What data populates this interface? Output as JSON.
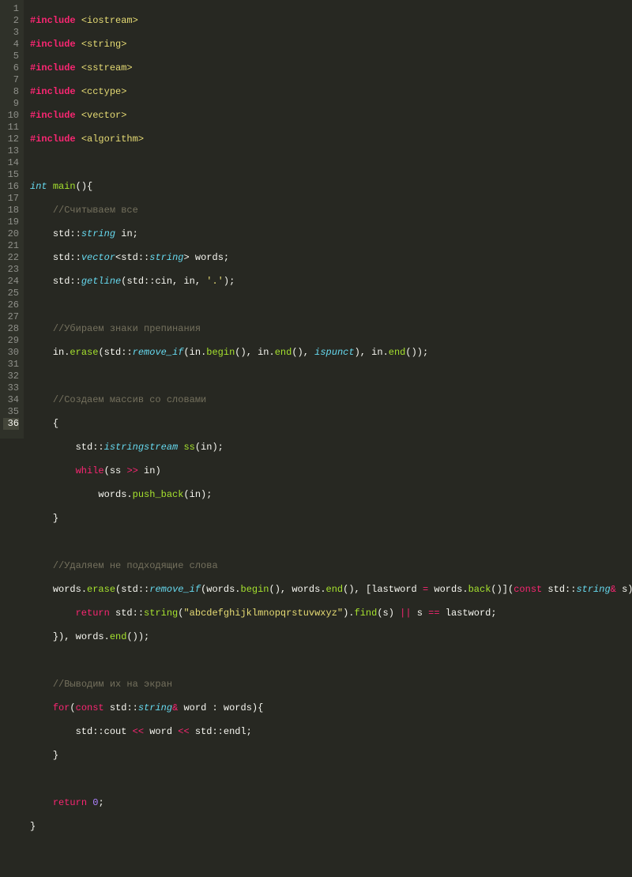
{
  "gutter": {
    "start": 1,
    "end": 36,
    "active": 36
  },
  "code": {
    "l1": {
      "include": "#include",
      "hdr": "<iostream>"
    },
    "l2": {
      "include": "#include",
      "hdr": "<string>"
    },
    "l3": {
      "include": "#include",
      "hdr": "<sstream>"
    },
    "l4": {
      "include": "#include",
      "hdr": "<cctype>"
    },
    "l5": {
      "include": "#include",
      "hdr": "<vector>"
    },
    "l6": {
      "include": "#include",
      "hdr": "<algorithm>"
    },
    "l8": {
      "kw": "int",
      "fn": "main",
      "rest": "(){"
    },
    "l9": {
      "c": "//Считываем все"
    },
    "l10": {
      "a": "std::",
      "b": "string",
      "c": " in;"
    },
    "l11": {
      "a": "std::",
      "b": "vector",
      "c": "<std::",
      "d": "string",
      "e": "> words;"
    },
    "l12": {
      "a": "std::",
      "b": "getline",
      "c": "(std::cin, in, ",
      "d": "'.'",
      "e": ");"
    },
    "l14": {
      "c": "//Убираем знаки препинания"
    },
    "l15": {
      "a": "in.",
      "b": "erase",
      "c": "(std::",
      "d": "remove_if",
      "e": "(in.",
      "f": "begin",
      "g": "(), in.",
      "h": "end",
      "i": "(), ",
      "j": "ispunct",
      "k": "), in.",
      "l": "end",
      "m": "());"
    },
    "l17": {
      "c": "//Создаем массив со словами"
    },
    "l18": {
      "a": "{"
    },
    "l19": {
      "a": "std::",
      "b": "istringstream",
      "c": " ",
      "d": "ss",
      "e": "(in);"
    },
    "l20": {
      "a": "while",
      "b": "(ss ",
      "c": ">>",
      "d": " in)"
    },
    "l21": {
      "a": "words.",
      "b": "push_back",
      "c": "(in);"
    },
    "l22": {
      "a": "}"
    },
    "l24": {
      "c": "//Удаляем не подходящие слова"
    },
    "l25": {
      "a": "words.",
      "b": "erase",
      "c": "(std::",
      "d": "remove_if",
      "e": "(words.",
      "f": "begin",
      "g": "(), words.",
      "h": "end",
      "i": "(), [lastword ",
      "j": "=",
      "k": " words.",
      "l": "back",
      "m": "()](",
      "n": "const",
      "o": " std::",
      "p": "string",
      "q": "&",
      "r": " s){"
    },
    "l26": {
      "a": "return",
      "b": " std::",
      "c": "string",
      "d": "(",
      "e": "\"abcdefghijklmnopqrstuvwxyz\"",
      "f": ").",
      "g": "find",
      "h": "(s) ",
      "i": "||",
      "j": " s ",
      "k": "==",
      "l": " lastword;"
    },
    "l27": {
      "a": "}), words.",
      "b": "end",
      "c": "());"
    },
    "l29": {
      "c": "//Выводим их на экран"
    },
    "l30": {
      "a": "for",
      "b": "(",
      "c": "const",
      "d": " std::",
      "e": "string",
      "f": "&",
      "g": " word : words){"
    },
    "l31": {
      "a": "std::cout ",
      "b": "<<",
      "c": " word ",
      "d": "<<",
      "e": " std::endl;"
    },
    "l32": {
      "a": "}"
    },
    "l34": {
      "a": "return",
      "b": " ",
      "c": "0",
      "d": ";"
    },
    "l35": {
      "a": "}"
    }
  }
}
